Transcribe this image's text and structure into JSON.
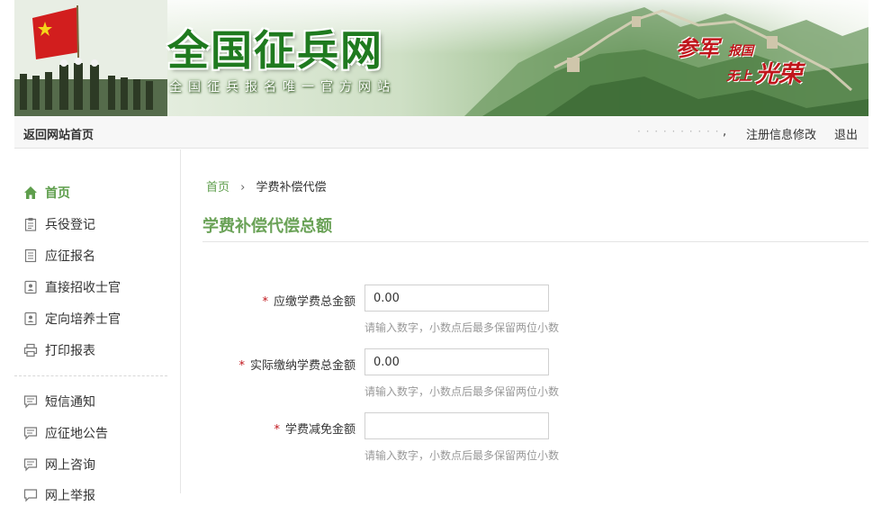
{
  "banner": {
    "title": "全国征兵网",
    "subtitle": "全国征兵报名唯一官方网站",
    "slogan": {
      "part1": "参军",
      "part2": "报国",
      "part3": "无上",
      "part4": "光荣"
    }
  },
  "topbar": {
    "home_link": "返回网站首页",
    "user_name": "· · · · · · · · · ·",
    "comma": ",",
    "edit_link": "注册信息修改",
    "logout_link": "退出"
  },
  "sidebar": {
    "items": [
      {
        "label": "首页",
        "icon": "home-icon",
        "active": true
      },
      {
        "label": "兵役登记",
        "icon": "clipboard-icon"
      },
      {
        "label": "应征报名",
        "icon": "document-icon"
      },
      {
        "label": "直接招收士官",
        "icon": "id-card-icon"
      },
      {
        "label": "定向培养士官",
        "icon": "id-card-icon"
      },
      {
        "label": "打印报表",
        "icon": "printer-icon"
      },
      {
        "label": "短信通知",
        "icon": "message-icon"
      },
      {
        "label": "应征地公告",
        "icon": "message-icon"
      },
      {
        "label": "网上咨询",
        "icon": "message-icon"
      },
      {
        "label": "网上举报",
        "icon": "message-icon"
      }
    ]
  },
  "breadcrumb": {
    "home": "首页",
    "separator": "›",
    "current": "学费补偿代偿"
  },
  "page_title": "学费补偿代偿总额",
  "form": {
    "fields": [
      {
        "required": "*",
        "label": "应缴学费总金额",
        "value": "0.00",
        "hint": "请输入数字，小数点后最多保留两位小数"
      },
      {
        "required": "*",
        "label": "实际缴纳学费总金额",
        "value": "0.00",
        "hint": "请输入数字，小数点后最多保留两位小数"
      },
      {
        "required": "*",
        "label": "学费减免金额",
        "value": "",
        "hint": "请输入数字，小数点后最多保留两位小数"
      }
    ]
  },
  "colors": {
    "accent_green": "#6aa257",
    "required_red": "#c0151b",
    "banner_green": "#1f7a1f"
  }
}
